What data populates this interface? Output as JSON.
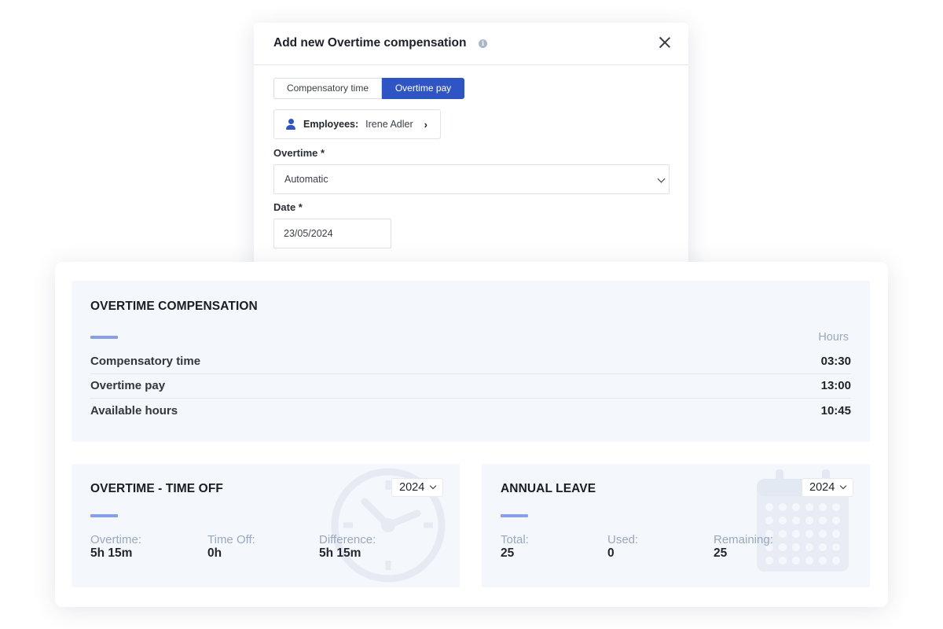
{
  "modal": {
    "title": "Add new Overtime compensation",
    "info_icon": "i",
    "tabs": [
      {
        "label": "Compensatory time",
        "active": false
      },
      {
        "label": "Overtime pay",
        "active": true
      }
    ],
    "employees": {
      "label": "Employees:",
      "value": "Irene Adler",
      "chevron": "›"
    },
    "overtime": {
      "label": "Overtime *",
      "value": "Automatic"
    },
    "date": {
      "label": "Date *",
      "value": "23/05/2024"
    }
  },
  "compensation": {
    "title": "OVERTIME COMPENSATION",
    "column_header": "Hours",
    "rows": [
      {
        "label": "Compensatory time",
        "value": "03:30"
      },
      {
        "label": "Overtime pay",
        "value": "13:00"
      },
      {
        "label": "Available hours",
        "value": "10:45"
      }
    ]
  },
  "time_off": {
    "title": "OVERTIME - TIME OFF",
    "year": "2024",
    "stats": [
      {
        "label": "Overtime:",
        "value": "5h 15m"
      },
      {
        "label": "Time Off:",
        "value": "0h"
      },
      {
        "label": "Difference:",
        "value": "5h 15m"
      }
    ]
  },
  "annual_leave": {
    "title": "ANNUAL LEAVE",
    "year": "2024",
    "stats": [
      {
        "label": "Total:",
        "value": "25"
      },
      {
        "label": "Used:",
        "value": "0"
      },
      {
        "label": "Remaining:",
        "value": "25"
      }
    ]
  },
  "colors": {
    "accent": "#2f55c4",
    "accent_bar": "#8aa0e6",
    "panel_bg": "#f4f7fb",
    "muted_text": "#9aa7bd"
  }
}
